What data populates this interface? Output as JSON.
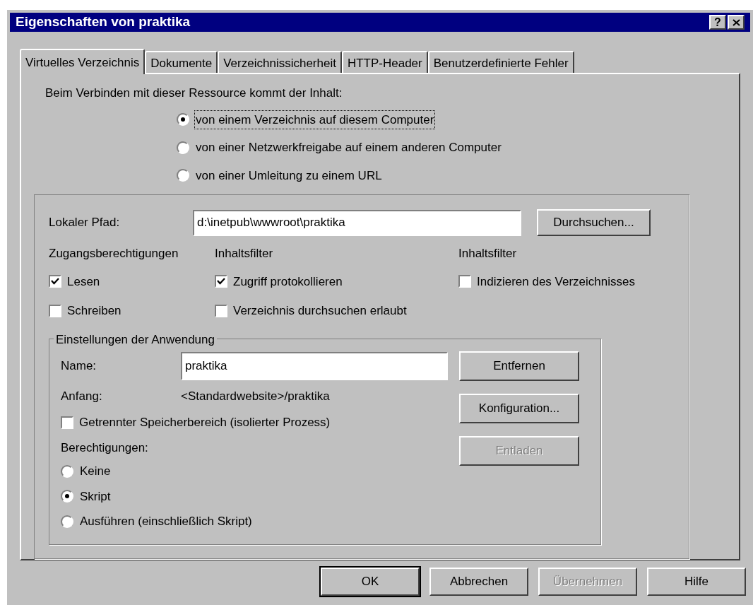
{
  "window": {
    "title": "Eigenschaften von praktika",
    "help_button": "?"
  },
  "tabs": [
    {
      "label": "Virtuelles Verzeichnis",
      "selected": true
    },
    {
      "label": "Dokumente",
      "selected": false
    },
    {
      "label": "Verzeichnissicherheit",
      "selected": false
    },
    {
      "label": "HTTP-Header",
      "selected": false
    },
    {
      "label": "Benutzerdefinierte Fehler",
      "selected": false
    }
  ],
  "source": {
    "label": "Beim Verbinden mit dieser Ressource kommt der Inhalt:",
    "options": [
      {
        "label": "von einem Verzeichnis auf diesem Computer",
        "selected": true,
        "focused": true
      },
      {
        "label": "von einer Netzwerkfreigabe auf einem anderen Computer",
        "selected": false,
        "focused": false
      },
      {
        "label": "von einer Umleitung zu einem URL",
        "selected": false,
        "focused": false
      }
    ]
  },
  "local_path": {
    "label": "Lokaler Pfad:",
    "value": "d:\\inetpub\\wwwroot\\praktika",
    "button": "Durchsuchen..."
  },
  "groups": [
    {
      "heading": "Zugangsberechtigungen",
      "items": [
        {
          "label": "Lesen",
          "checked": true
        },
        {
          "label": "Schreiben",
          "checked": false
        }
      ]
    },
    {
      "heading": "Inhaltsfilter",
      "items": [
        {
          "label": "Zugriff protokollieren",
          "checked": true
        },
        {
          "label": "Verzeichnis durchsuchen erlaubt",
          "checked": false
        }
      ]
    },
    {
      "heading": "Inhaltsfilter",
      "items": [
        {
          "label": "Indizieren des Verzeichnisses",
          "checked": false
        }
      ]
    }
  ],
  "app_settings": {
    "legend": "Einstellungen der Anwendung",
    "name_label": "Name:",
    "name_value": "praktika",
    "start_label": "Anfang:",
    "start_value": "<Standardwebsite>/praktika",
    "isolated": {
      "label": "Getrennter Speicherbereich (isolierter Prozess)",
      "checked": false
    },
    "permissions_label": "Berechtigungen:",
    "permissions": [
      {
        "label": "Keine",
        "selected": false
      },
      {
        "label": "Skript",
        "selected": true
      },
      {
        "label": "Ausführen (einschließlich Skript)",
        "selected": false
      }
    ],
    "buttons": [
      {
        "label": "Entfernen",
        "disabled": false
      },
      {
        "label": "Konfiguration...",
        "disabled": false
      },
      {
        "label": "Entladen",
        "disabled": true
      }
    ]
  },
  "footer_buttons": [
    {
      "label": "OK",
      "disabled": false,
      "default": true
    },
    {
      "label": "Abbrechen",
      "disabled": false,
      "default": false
    },
    {
      "label": "Übernehmen",
      "disabled": true,
      "default": false
    },
    {
      "label": "Hilfe",
      "disabled": false,
      "default": false
    }
  ]
}
